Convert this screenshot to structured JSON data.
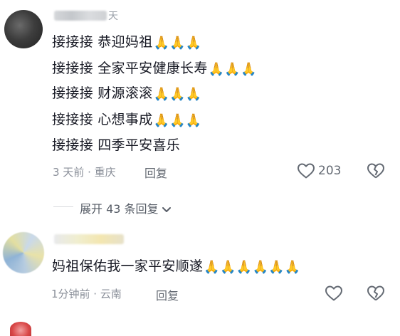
{
  "comment1": {
    "username_visible_part": "天",
    "lines": [
      {
        "text": "接接接 恭迎妈祖",
        "emoji": "🙏🙏🙏"
      },
      {
        "text": "接接接 全家平安健康长寿",
        "emoji": "🙏🙏🙏"
      },
      {
        "text": "接接接 财源滚滚",
        "emoji": "🙏🙏🙏"
      },
      {
        "text": "接接接 心想事成",
        "emoji": "🙏🙏🙏"
      },
      {
        "text": "接接接 四季平安喜乐",
        "emoji": ""
      }
    ],
    "meta": "3 天前 · 重庆",
    "reply_label": "回复",
    "like_count": "203",
    "expand_label": "展开 43 条回复"
  },
  "comment2": {
    "text": "妈祖保佑我一家平安顺遂",
    "emoji": "🙏🙏🙏🙏🙏🙏",
    "meta": "1分钟前 · 云南",
    "reply_label": "回复"
  },
  "colors": {
    "text": "#161823",
    "meta": "#8a8f99",
    "icon": "#646a73"
  },
  "icons": {
    "like": "heart-outline-icon",
    "dislike": "broken-heart-icon",
    "expand": "chevron-down-icon"
  }
}
